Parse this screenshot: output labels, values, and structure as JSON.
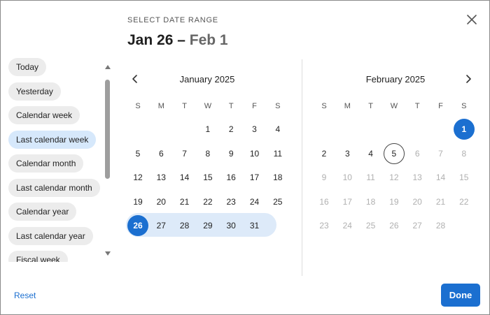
{
  "header": {
    "label": "SELECT DATE RANGE",
    "range_start": "Jan 26",
    "range_dash": "–",
    "range_end": "Feb 1"
  },
  "presets": [
    {
      "label": "Today",
      "active": false
    },
    {
      "label": "Yesterday",
      "active": false
    },
    {
      "label": "Calendar week",
      "active": false
    },
    {
      "label": "Last calendar week",
      "active": true
    },
    {
      "label": "Calendar month",
      "active": false
    },
    {
      "label": "Last calendar month",
      "active": false
    },
    {
      "label": "Calendar year",
      "active": false
    },
    {
      "label": "Last calendar year",
      "active": false
    },
    {
      "label": "Fiscal week",
      "active": false
    }
  ],
  "weekday_labels": [
    "S",
    "M",
    "T",
    "W",
    "T",
    "F",
    "S"
  ],
  "months": [
    {
      "title": "January 2025",
      "weeks": [
        [
          "",
          "",
          "",
          "1",
          "2",
          "3",
          "4"
        ],
        [
          "5",
          "6",
          "7",
          "8",
          "9",
          "10",
          "11"
        ],
        [
          "12",
          "13",
          "14",
          "15",
          "16",
          "17",
          "18"
        ],
        [
          "19",
          "20",
          "21",
          "22",
          "23",
          "24",
          "25"
        ],
        [
          "26",
          "27",
          "28",
          "29",
          "30",
          "31",
          ""
        ]
      ],
      "selected": [
        "26"
      ],
      "in_range": [
        "26",
        "27",
        "28",
        "29",
        "30",
        "31"
      ],
      "today": "",
      "muted_from": 0
    },
    {
      "title": "February 2025",
      "weeks": [
        [
          "",
          "",
          "",
          "",
          "",
          "",
          "1"
        ],
        [
          "2",
          "3",
          "4",
          "5",
          "6",
          "7",
          "8"
        ],
        [
          "9",
          "10",
          "11",
          "12",
          "13",
          "14",
          "15"
        ],
        [
          "16",
          "17",
          "18",
          "19",
          "20",
          "21",
          "22"
        ],
        [
          "23",
          "24",
          "25",
          "26",
          "27",
          "28",
          ""
        ]
      ],
      "selected": [
        "1"
      ],
      "in_range": [],
      "today": "5",
      "muted_from": 6
    }
  ],
  "footer": {
    "reset_label": "Reset",
    "done_label": "Done"
  },
  "colors": {
    "accent": "#1b6fd0",
    "range_fill": "#ddeaf9",
    "active_chip": "#d6e8fb",
    "chip": "#ececec"
  },
  "icons": {
    "close": "close-icon",
    "prev": "chevron-left-icon",
    "next": "chevron-right-icon"
  }
}
